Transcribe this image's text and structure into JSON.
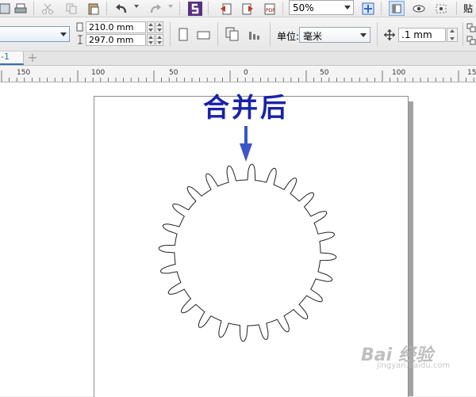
{
  "toolbar": {
    "zoom_value": "50%",
    "paste_label": "贴"
  },
  "property_bar": {
    "width_value": "210.0 mm",
    "height_value": "297.0 mm",
    "units_label": "单位:",
    "units_value": "毫米",
    "nudge_value": ".1 mm"
  },
  "tabs": {
    "page_label": "-1",
    "add_label": "+"
  },
  "ruler": {
    "ticks": [
      "150",
      "100",
      "50",
      "0",
      "50",
      "100",
      "150"
    ]
  },
  "canvas": {
    "annotation_text": "合并后",
    "watermark_text": "Bai 经验",
    "watermark_sub": "jingyan.baidu.com"
  },
  "colors": {
    "annotation": "#1a22a8",
    "arrow": "#3b56c8",
    "accent": "#2e6fb5"
  }
}
